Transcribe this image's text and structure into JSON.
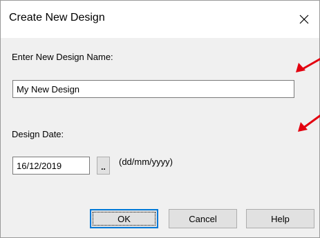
{
  "window": {
    "title": "Create New Design",
    "close_glyph": "✕"
  },
  "form": {
    "name_label": "Enter New Design Name:",
    "name_value": "My New Design",
    "date_label": "Design Date:",
    "date_value": "16/12/2019",
    "date_picker_label": "..",
    "date_format_hint": "(dd/mm/yyyy)"
  },
  "buttons": {
    "ok": "OK",
    "cancel": "Cancel",
    "help": "Help"
  },
  "annotations": {
    "arrow_color": "#e3000f",
    "arrows": [
      "arrow-icon",
      "arrow-icon"
    ]
  }
}
